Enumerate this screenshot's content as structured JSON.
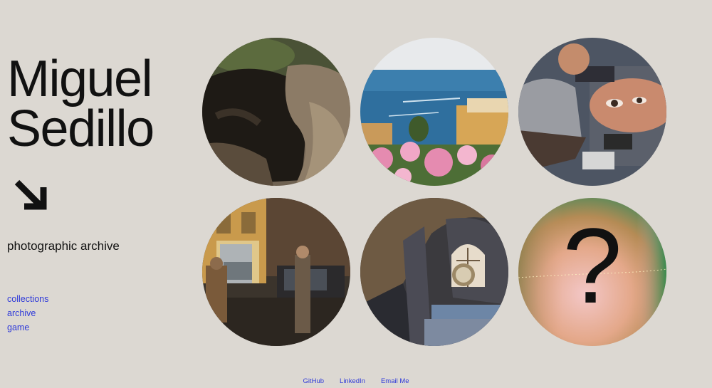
{
  "header": {
    "name_line1": "Miguel",
    "name_line2": "Sedillo",
    "subtitle": "photographic archive",
    "arrow_icon": "arrow-down-right-icon"
  },
  "nav": {
    "items": [
      {
        "label": "collections"
      },
      {
        "label": "archive"
      },
      {
        "label": "game"
      }
    ]
  },
  "gallery": {
    "mystery_symbol": "?"
  },
  "footer": {
    "links": [
      {
        "label": "GitHub"
      },
      {
        "label": "LinkedIn"
      },
      {
        "label": "Email Me"
      }
    ]
  },
  "colors": {
    "background": "#dcd8d2",
    "link": "#2f3ad9",
    "text": "#111111"
  }
}
